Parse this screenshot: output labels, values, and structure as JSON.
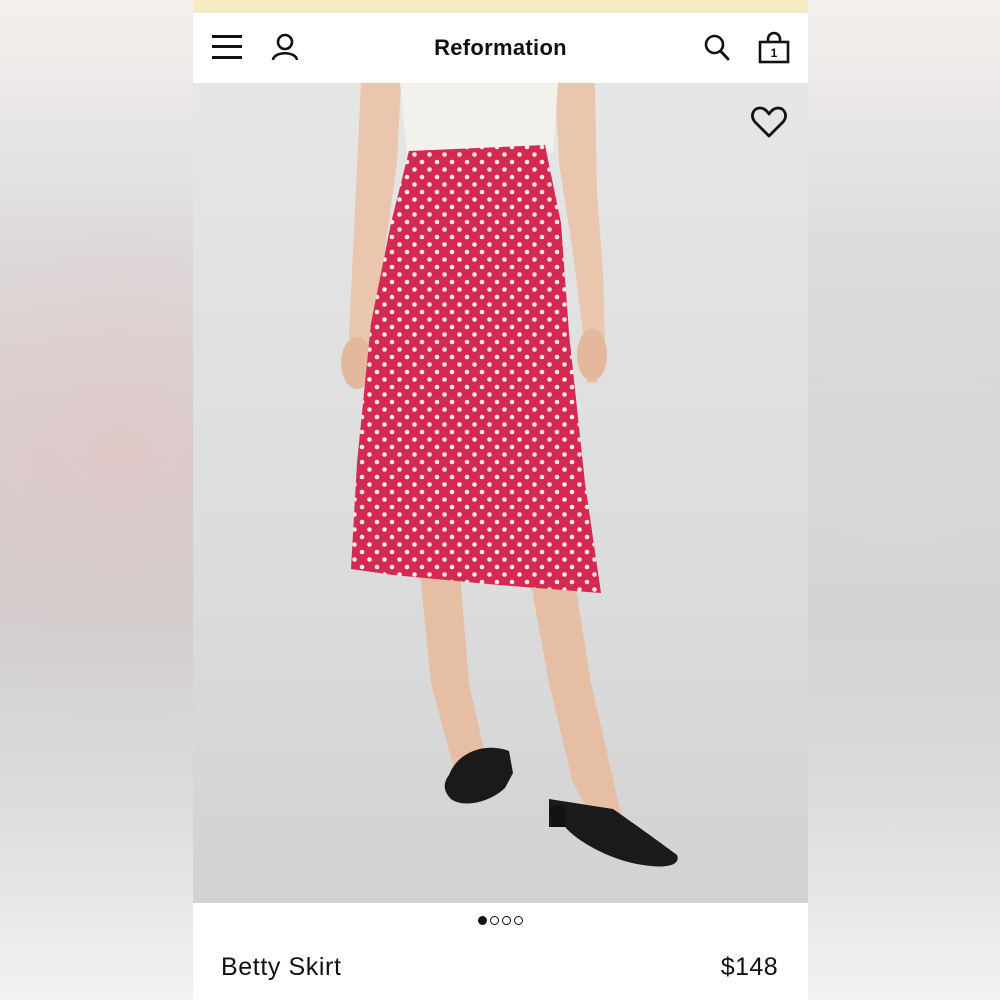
{
  "header": {
    "brand": "Reformation",
    "icons": [
      "menu-icon",
      "account-icon",
      "search-icon",
      "bag-icon"
    ],
    "bag_count": "1"
  },
  "product": {
    "image_alt": "Model wearing a red polka dot midi skirt with black strappy sandals",
    "gallery_total": 4,
    "gallery_current": 1,
    "name": "Betty Skirt",
    "price": "$148"
  },
  "colors": {
    "banner": "#f6ecc4",
    "skirt": "#d42a52",
    "text": "#111111"
  }
}
